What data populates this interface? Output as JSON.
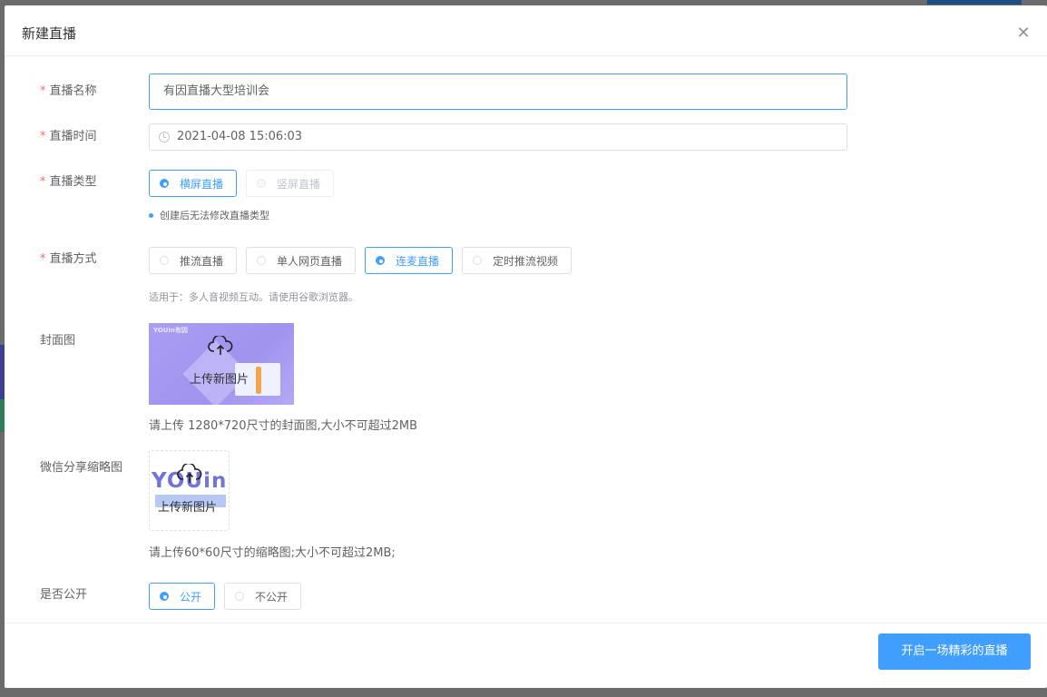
{
  "dialog": {
    "title": "新建直播",
    "close_icon": "close-icon"
  },
  "form": {
    "name": {
      "label": "直播名称",
      "value": "有因直播大型培训会"
    },
    "time": {
      "label": "直播时间",
      "value": "2021-04-08 15:06:03",
      "icon": "clock-icon"
    },
    "type": {
      "label": "直播类型",
      "options": [
        {
          "label": "横屏直播",
          "state": "selected"
        },
        {
          "label": "竖屏直播",
          "state": "disabled"
        }
      ],
      "hint": "创建后无法修改直播类型"
    },
    "mode": {
      "label": "直播方式",
      "options": [
        {
          "label": "推流直播",
          "state": "unselected"
        },
        {
          "label": "单人网页直播",
          "state": "unselected"
        },
        {
          "label": "连麦直播",
          "state": "selected"
        },
        {
          "label": "定时推流视频",
          "state": "unselected"
        }
      ],
      "hint": "适用于：多人音视频互动。请使用谷歌浏览器。"
    },
    "cover": {
      "label": "封面图",
      "upload_text": "上传新图片",
      "brand_text": "YOUin有因",
      "note": "请上传 1280*720尺寸的封面图,大小不可超过2MB"
    },
    "wechat_thumb": {
      "label": "微信分享缩略图",
      "upload_text": "上传新图片",
      "logo_text": "YOUin",
      "note": "请上传60*60尺寸的缩略图;大小不可超过2MB;"
    },
    "public": {
      "label": "是否公开",
      "options": [
        {
          "label": "公开",
          "state": "selected"
        },
        {
          "label": "不公开",
          "state": "unselected"
        }
      ]
    },
    "required_mark": "*"
  },
  "footer": {
    "submit_label": "开启一场精彩的直播"
  },
  "colors": {
    "primary": "#409eff",
    "required": "#f56c6c",
    "overlay": "#6b6b6b"
  }
}
